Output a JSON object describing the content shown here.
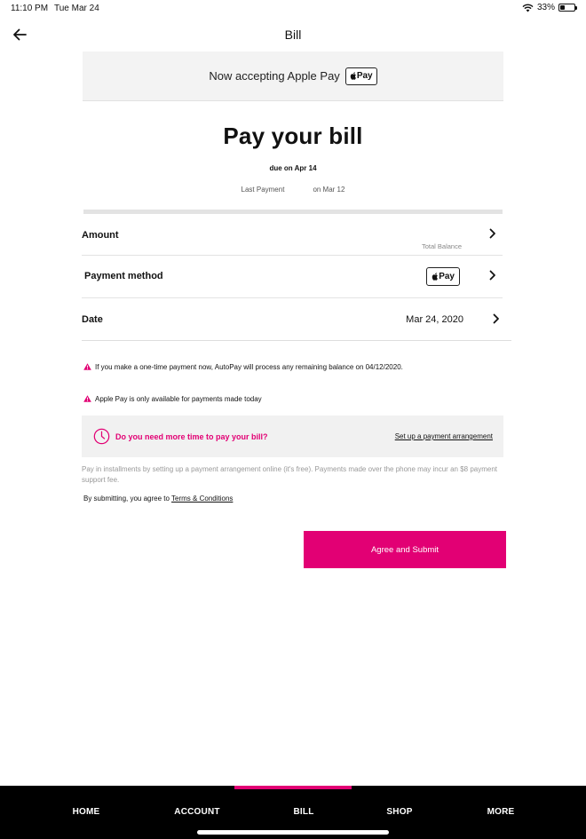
{
  "status_bar": {
    "time": "11:10 PM",
    "date": "Tue Mar 24",
    "battery": "33%",
    "battery_level": 0.33
  },
  "header": {
    "title": "Bill",
    "back_icon": "arrow-left-icon"
  },
  "banner": {
    "text": "Now accepting Apple Pay",
    "badge": "Pay"
  },
  "hero": {
    "title": "Pay your bill",
    "due": "due on Apr 14",
    "last_payment_label": "Last Payment",
    "last_payment_date": "on Mar 12"
  },
  "rows": {
    "amount": {
      "label": "Amount",
      "sub": "Total Balance"
    },
    "method": {
      "label": "Payment method",
      "badge": "Pay"
    },
    "date": {
      "label": "Date",
      "value": "Mar 24, 2020"
    }
  },
  "warnings": [
    "If you make a one-time payment now, AutoPay will process any remaining balance on 04/12/2020.",
    "Apple Pay is only available for payments made today"
  ],
  "arrangement": {
    "question": "Do you need more time to pay your bill?",
    "link": "Set up a payment arrangement"
  },
  "note": "Pay in installments by setting up a payment arrangement online (it's free). Payments made over the phone may incur an $8 payment support fee.",
  "terms": {
    "prefix": "By submitting, you agree to",
    "link": "Terms & Conditions"
  },
  "submit_label": "Agree and Submit",
  "nav": {
    "items": [
      "HOME",
      "ACCOUNT",
      "BILL",
      "SHOP",
      "MORE"
    ],
    "active": "BILL"
  },
  "colors": {
    "accent": "#e20074",
    "nav_bg": "#000000",
    "banner_bg": "#f3f3f3"
  }
}
